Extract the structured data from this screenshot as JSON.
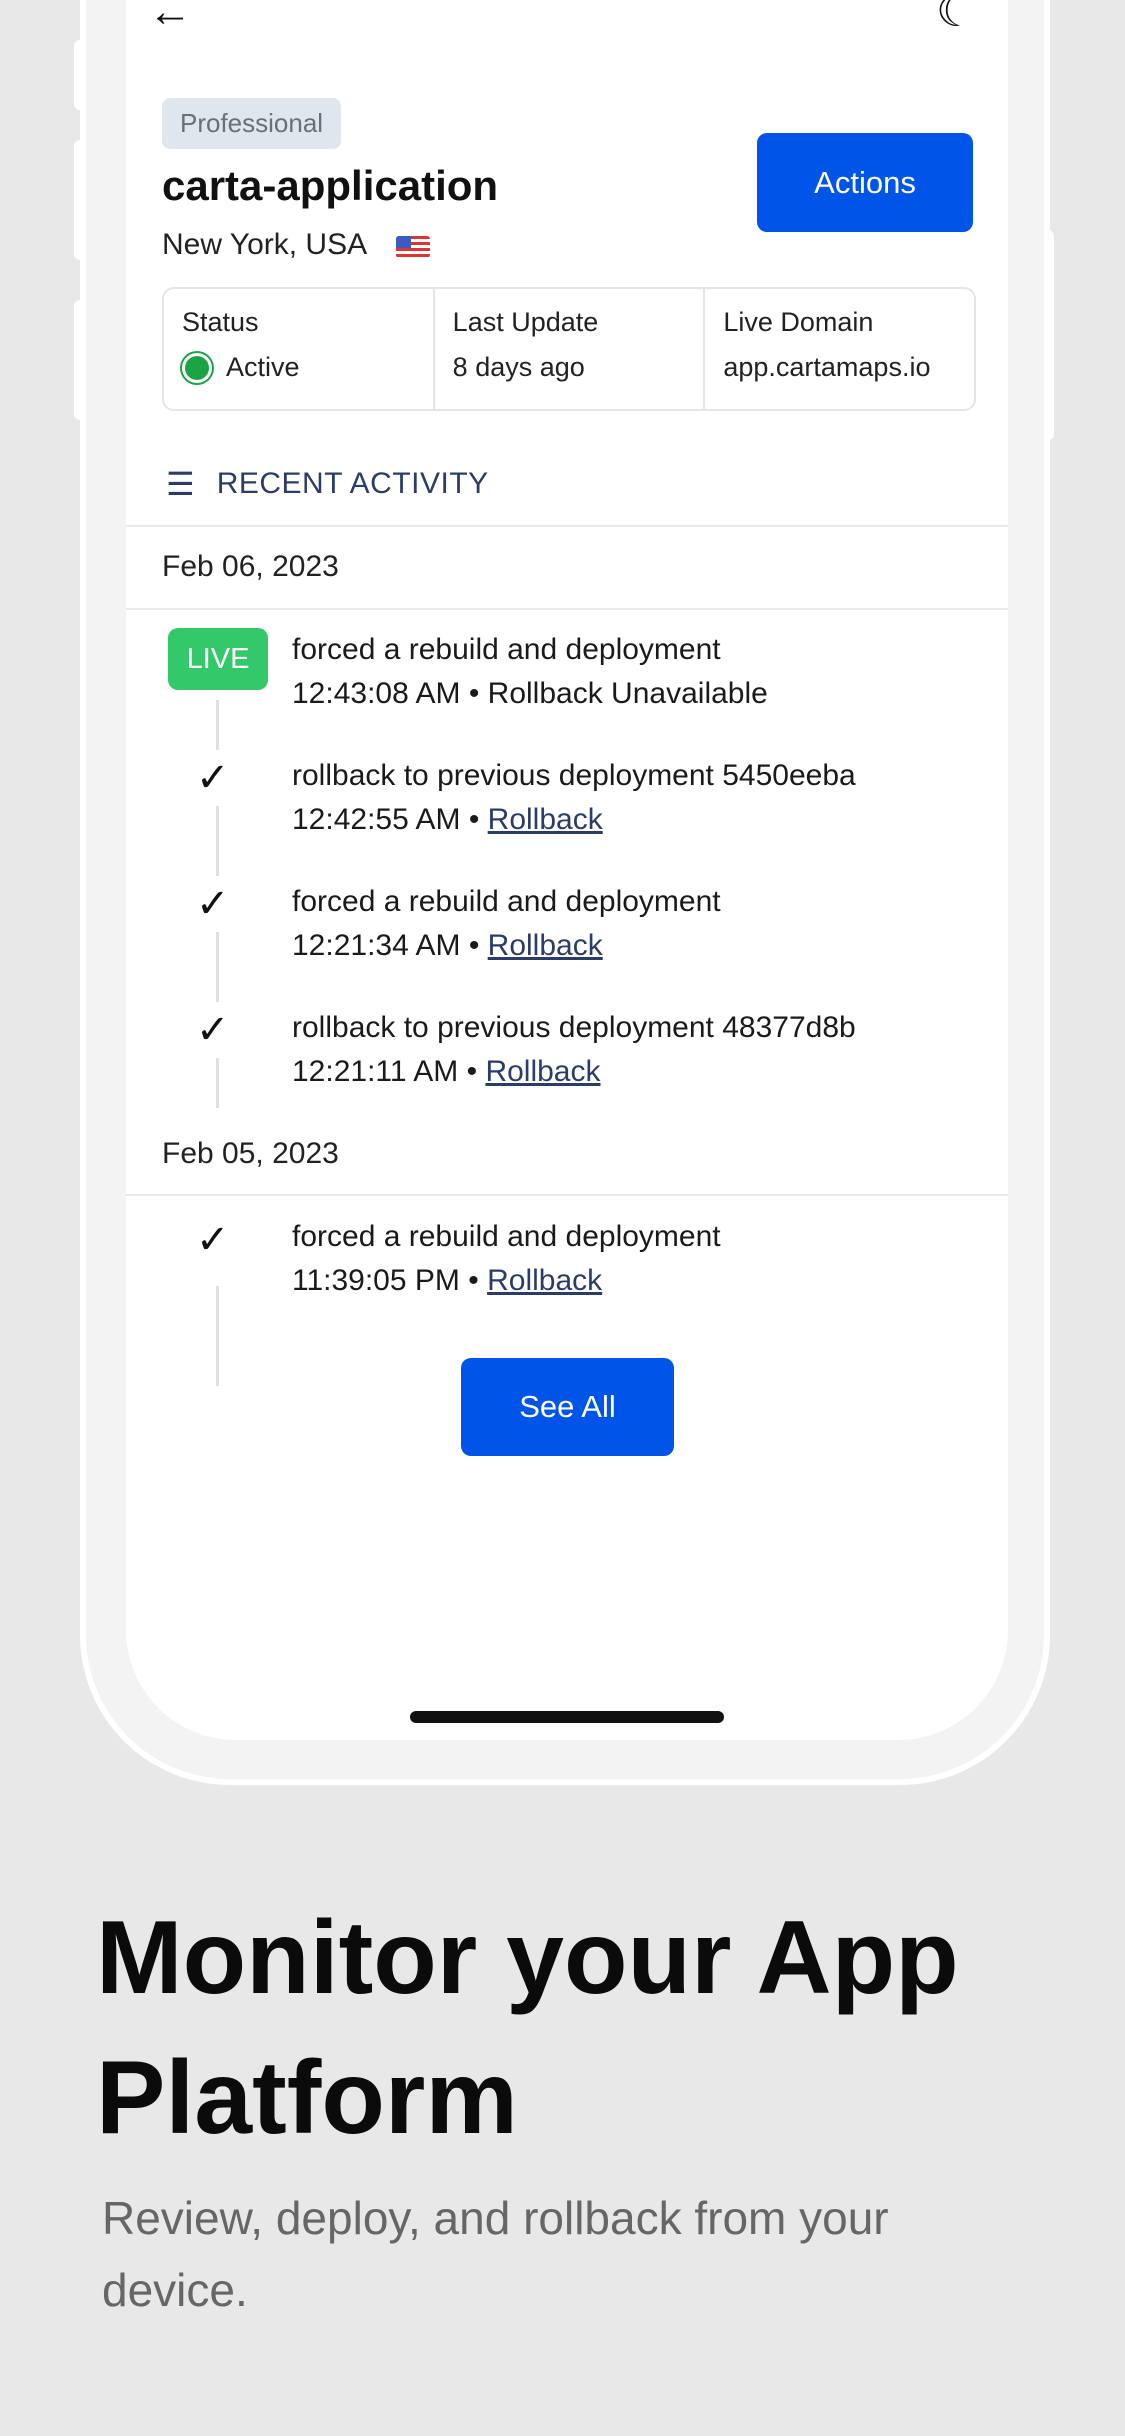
{
  "header": {
    "back_icon": "arrow-left-icon",
    "theme_icon": "moon-icon"
  },
  "app": {
    "plan_badge": "Professional",
    "title": "carta-application",
    "location": "New York, USA",
    "flag_icon": "us-flag-icon",
    "actions_label": "Actions"
  },
  "info": {
    "status_label": "Status",
    "status_value": "Active",
    "status_color": "#1aa446",
    "update_label": "Last Update",
    "update_value": "8 days ago",
    "domain_label": "Live Domain",
    "domain_value": "app.cartamaps.io"
  },
  "activity": {
    "heading": "RECENT ACTIVITY",
    "groups": [
      {
        "date": "Feb 06, 2023",
        "items": [
          {
            "badge": "LIVE",
            "title": "forced a rebuild and deployment",
            "time": "12:43:08 AM",
            "sep": "•",
            "action": "Rollback Unavailable"
          },
          {
            "title": "rollback to previous deployment 5450eeba",
            "time": "12:42:55 AM",
            "sep": "•",
            "action": "Rollback"
          },
          {
            "title": "forced a rebuild and deployment",
            "time": "12:21:34 AM",
            "sep": "•",
            "action": "Rollback"
          },
          {
            "title": "rollback to previous deployment 48377d8b",
            "time": "12:21:11 AM",
            "sep": "•",
            "action": "Rollback"
          }
        ]
      },
      {
        "date": "Feb 05, 2023",
        "items": [
          {
            "title": "forced a rebuild and deployment",
            "time": "11:39:05 PM",
            "sep": "•",
            "action": "Rollback"
          }
        ]
      }
    ],
    "see_all": "See All"
  },
  "promo": {
    "title": "Monitor your App Platform",
    "subtitle": "Review, deploy, and rollback from your device."
  },
  "colors": {
    "accent": "#0055e8",
    "live": "#33c96a",
    "link": "#2b3d66"
  }
}
